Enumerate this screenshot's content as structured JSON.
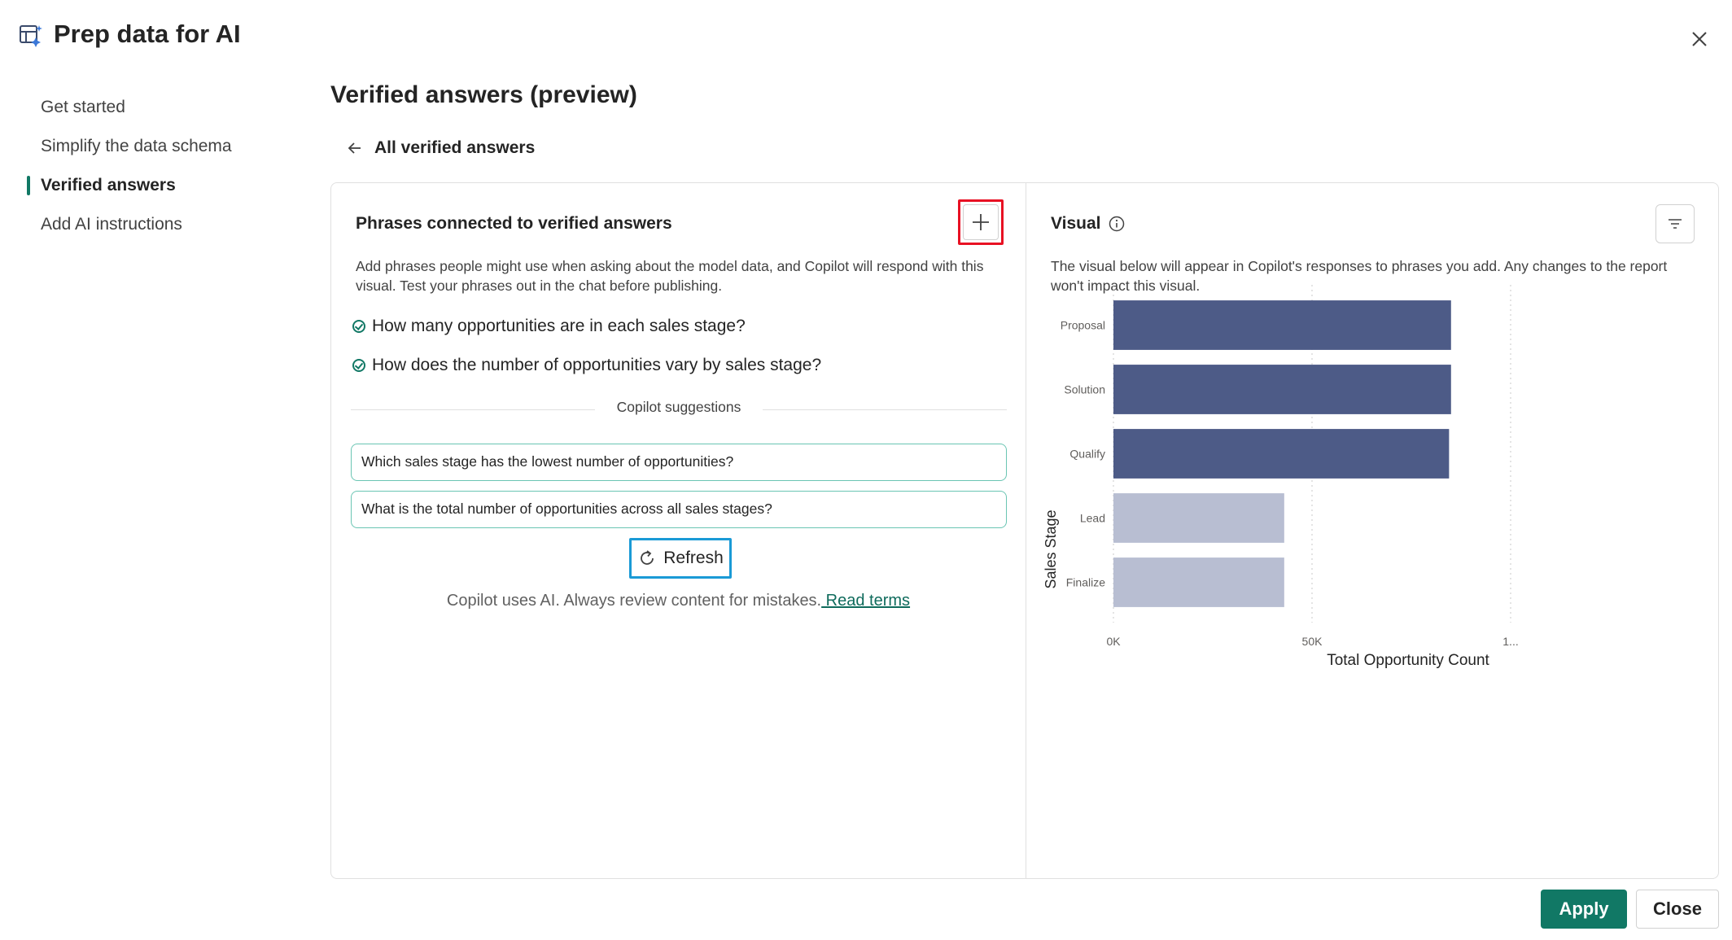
{
  "window": {
    "title": "Prep data for AI",
    "icon": "prep-data-icon",
    "close_icon": "close-icon"
  },
  "sidebar": {
    "items": [
      {
        "label": "Get started",
        "active": false
      },
      {
        "label": "Simplify the data schema",
        "active": false
      },
      {
        "label": "Verified answers",
        "active": true
      },
      {
        "label": "Add AI instructions",
        "active": false
      }
    ]
  },
  "page": {
    "title": "Verified answers (preview)",
    "back_link": "All verified answers"
  },
  "phrases_panel": {
    "title": "Phrases connected to verified answers",
    "description": "Add phrases people might use when asking about the model data, and Copilot will respond with this visual. Test your phrases out in the chat before publishing.",
    "phrases": [
      "How many opportunities are in each sales stage?",
      "How does the number of opportunities vary by sales stage?"
    ],
    "suggestions_label": "Copilot suggestions",
    "suggestions": [
      "Which sales stage has the lowest number of opportunities?",
      "What is the total number of opportunities across all sales stages?"
    ],
    "refresh_label": "Refresh",
    "disclaimer": "Copilot uses AI. Always review content for mistakes.",
    "read_terms": " Read terms"
  },
  "visual_panel": {
    "title": "Visual",
    "description": "The visual below will appear in Copilot's responses to phrases you add. Any changes to the report won't impact this visual."
  },
  "chart_data": {
    "type": "bar",
    "orientation": "horizontal",
    "categories": [
      "Proposal",
      "Solution",
      "Qualify",
      "Lead",
      "Finalize"
    ],
    "values": [
      85000,
      85000,
      84500,
      43000,
      43000
    ],
    "highlighted": [
      true,
      true,
      true,
      false,
      false
    ],
    "xlabel": "Total Opportunity Count",
    "ylabel": "Sales Stage",
    "xticks": [
      "0K",
      "50K",
      "1..."
    ],
    "xlim": [
      0,
      100000
    ],
    "grid": true,
    "colors": {
      "highlight": "#4d5b87",
      "muted": "#b8bed2"
    }
  },
  "footer": {
    "apply_label": "Apply",
    "close_label": "Close"
  },
  "colors": {
    "accent": "#117865",
    "add_highlight": "#e81123",
    "refresh_highlight": "#1a9ad6"
  }
}
